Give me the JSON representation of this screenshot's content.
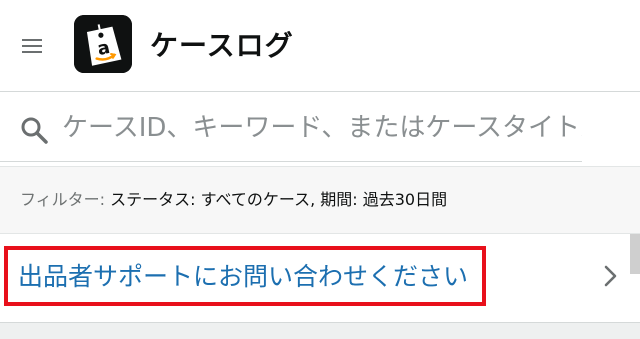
{
  "header": {
    "title": "ケースログ",
    "menu_icon": "hamburger-menu-icon",
    "logo_icon": "amazon-seller-tag-icon",
    "logo_letter": "a"
  },
  "search": {
    "placeholder": "ケースID、キーワード、またはケースタイトルで検索",
    "value": "",
    "icon": "search-icon"
  },
  "filter": {
    "prefix": "フィルター:",
    "text": " ステータス: すべてのケース, 期間: 過去30日間"
  },
  "support_link": {
    "label": "出品者サポートにお問い合わせください",
    "icon": "chevron-right-icon"
  },
  "colors": {
    "link": "#1c6fb0",
    "highlight": "#e8101b",
    "logo_bg": "#0f1111",
    "logo_smile": "#ff9900"
  }
}
